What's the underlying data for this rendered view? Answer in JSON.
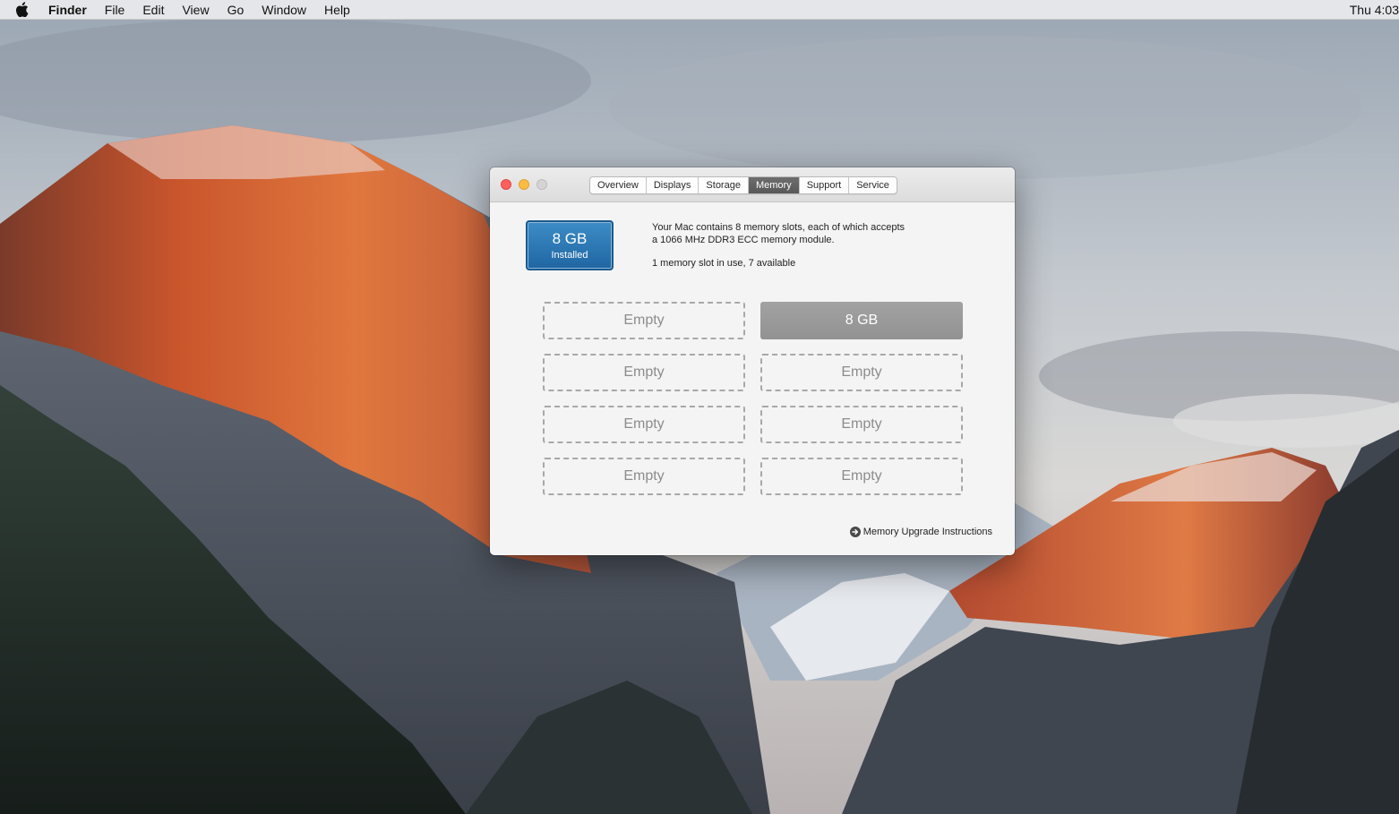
{
  "menubar": {
    "apple_icon": "apple-icon",
    "app_name": "Finder",
    "items": [
      "File",
      "Edit",
      "View",
      "Go",
      "Window",
      "Help"
    ],
    "clock": "Thu 4:03"
  },
  "window": {
    "tabs": [
      {
        "label": "Overview",
        "active": false
      },
      {
        "label": "Displays",
        "active": false
      },
      {
        "label": "Storage",
        "active": false
      },
      {
        "label": "Memory",
        "active": true
      },
      {
        "label": "Support",
        "active": false
      },
      {
        "label": "Service",
        "active": false
      }
    ],
    "installed": {
      "size": "8 GB",
      "label": "Installed"
    },
    "info_line1": "Your Mac contains 8 memory slots, each of which accepts",
    "info_line2": "a 1066 MHz DDR3 ECC memory module.",
    "usage": "1 memory slot in use, 7 available",
    "slots": [
      {
        "label": "Empty",
        "filled": false
      },
      {
        "label": "8 GB",
        "filled": true
      },
      {
        "label": "Empty",
        "filled": false
      },
      {
        "label": "Empty",
        "filled": false
      },
      {
        "label": "Empty",
        "filled": false
      },
      {
        "label": "Empty",
        "filled": false
      },
      {
        "label": "Empty",
        "filled": false
      },
      {
        "label": "Empty",
        "filled": false
      }
    ],
    "upgrade_link": "Memory Upgrade Instructions",
    "upgrade_icon": "arrow-right-circle-icon"
  },
  "colors": {
    "active_tab": "#5f5f5f",
    "installed_badge": "#2a76b3",
    "filled_slot": "#9a9a9a",
    "close": "#fc605c",
    "minimize": "#fdbc40",
    "zoom": "#d4d4d4"
  }
}
